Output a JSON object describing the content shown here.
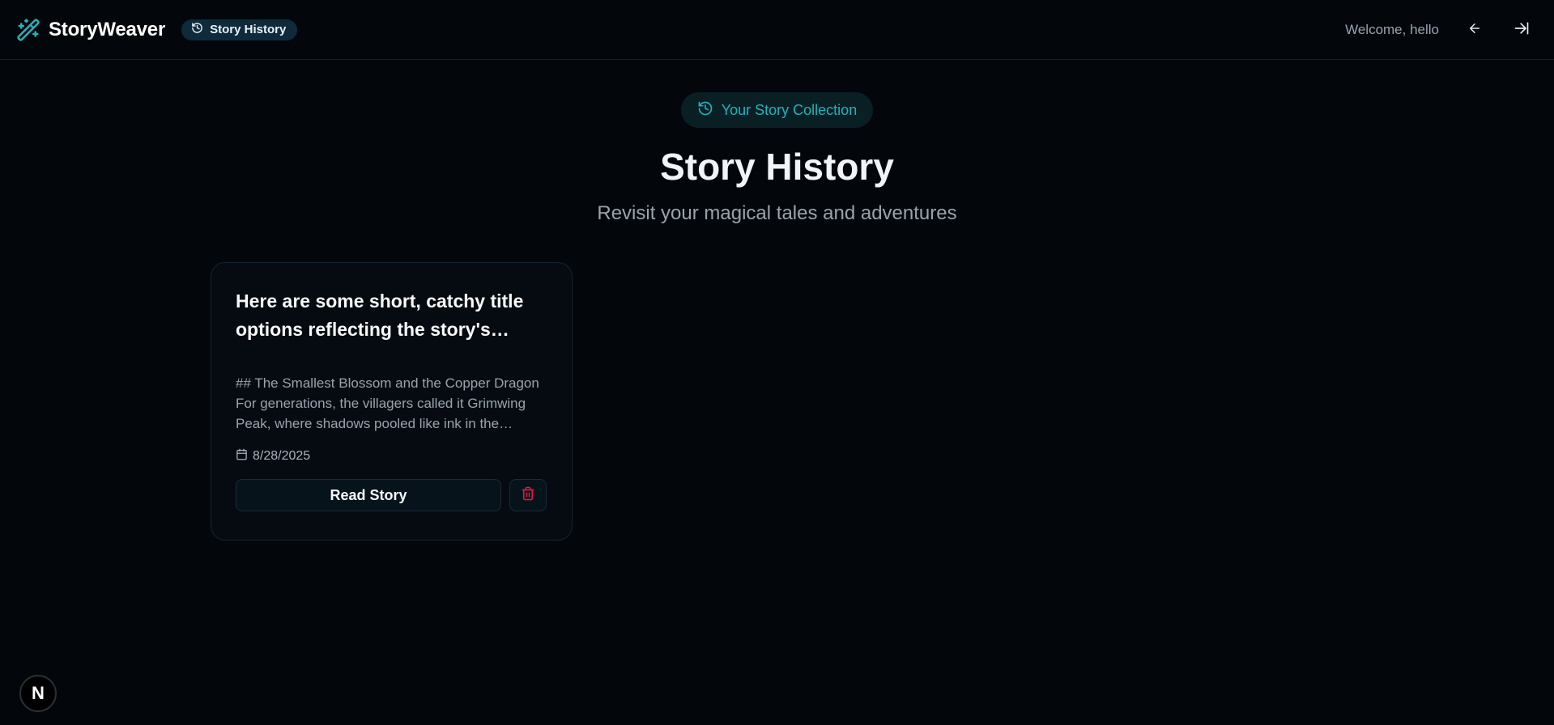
{
  "header": {
    "brand_name": "StoryWeaver",
    "nav_pill_label": "Story History",
    "welcome_text": "Welcome, hello",
    "icons": {
      "brand": "magic-wand-icon",
      "nav_pill": "history-icon",
      "back": "arrow-left-icon",
      "logout": "logout-icon"
    }
  },
  "hero": {
    "badge_label": "Your Story Collection",
    "title": "Story History",
    "subtitle": "Revisit your magical tales and adventures"
  },
  "stories": [
    {
      "title": "Here are some short, catchy title options reflecting the story's heart:",
      "excerpt": "## The Smallest Blossom and the Copper Dragon For generations, the villagers called it Grimwing Peak, where shadows pooled like ink in the crevices of the mountain.",
      "date": "8/28/2025",
      "read_label": "Read Story"
    }
  ],
  "next_badge_letter": "N",
  "colors": {
    "background": "#03070c",
    "accent": "#22b2b8",
    "danger": "#e11d48",
    "pill_bg": "#0f2a3a"
  }
}
